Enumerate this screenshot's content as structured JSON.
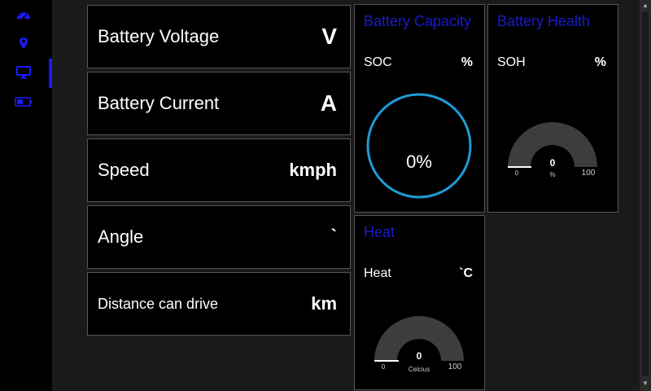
{
  "nav": {
    "items": [
      {
        "icon": "dashboard-icon"
      },
      {
        "icon": "location-pin-icon"
      },
      {
        "icon": "monitor-icon"
      },
      {
        "icon": "battery-icon"
      }
    ],
    "active_index": 2
  },
  "cards": {
    "voltage": {
      "label": "Battery Voltage",
      "unit": "V"
    },
    "current": {
      "label": "Battery Current",
      "unit": "A"
    },
    "speed": {
      "label": "Speed",
      "unit": "kmph"
    },
    "angle": {
      "label": "Angle",
      "unit": "`"
    },
    "distance": {
      "label": "Distance can drive",
      "unit": "km"
    }
  },
  "capacity": {
    "title": "Battery Capacity",
    "metric": "SOC",
    "unit": "%",
    "value_text": "0%",
    "ring_color": "#1e9bd7"
  },
  "health": {
    "title": "Battery Health",
    "metric": "SOH",
    "unit": "%",
    "gauge": {
      "value": "0",
      "min": "0",
      "max": "100",
      "unit_label": "%"
    }
  },
  "heat": {
    "title": "Heat",
    "metric": "Heat",
    "unit": "`C",
    "gauge": {
      "value": "0",
      "min": "0",
      "max": "100",
      "unit_label": "Celcius"
    }
  },
  "colors": {
    "accent": "#1a1aff",
    "title_blue": "#1a1acc",
    "panel_bg": "#000000",
    "gauge_track": "#3d3d3d"
  }
}
